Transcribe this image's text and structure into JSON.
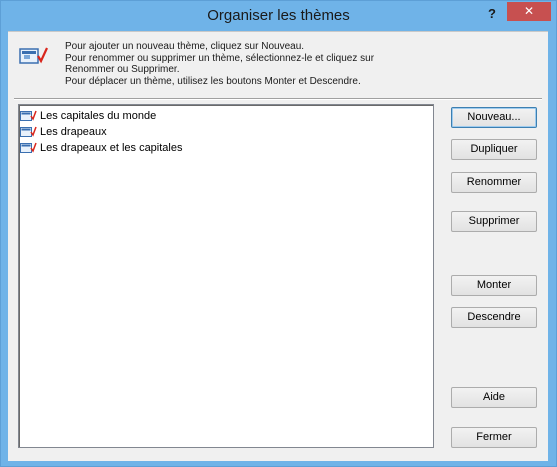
{
  "window": {
    "title": "Organiser les thèmes",
    "help_label": "?",
    "close_label": "✕"
  },
  "info": {
    "lines": [
      "Pour ajouter un nouveau thème, cliquez sur Nouveau.",
      "Pour renommer ou supprimer un thème, sélectionnez-le et cliquez sur",
      "Renommer ou Supprimer.",
      "Pour déplacer un thème, utilisez les boutons Monter et Descendre."
    ]
  },
  "themes": {
    "items": [
      {
        "label": "Les capitales du monde",
        "icon": "theme-icon"
      },
      {
        "label": "Les drapeaux",
        "icon": "theme-icon"
      },
      {
        "label": "Les drapeaux et les capitales",
        "icon": "theme-icon"
      }
    ]
  },
  "buttons": {
    "new": "Nouveau...",
    "duplicate": "Dupliquer",
    "rename": "Renommer",
    "delete": "Supprimer",
    "move_up": "Monter",
    "move_down": "Descendre",
    "help": "Aide",
    "close": "Fermer"
  },
  "colors": {
    "titlebar": "#6fb3e8",
    "close_button": "#c75050",
    "dialog_bg": "#f0f0f0",
    "icon_check": "#d9261c"
  }
}
